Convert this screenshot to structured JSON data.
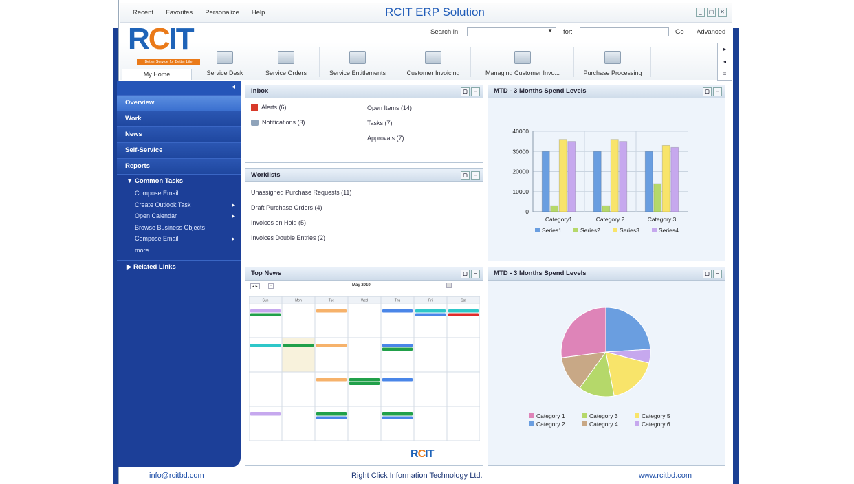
{
  "app": {
    "title": "RCIT ERP Solution",
    "menu": [
      "Recent",
      "Favorites",
      "Personalize",
      "Help"
    ],
    "window_buttons": {
      "minimize": "_",
      "restore": "▢",
      "close": "✕"
    }
  },
  "logo": {
    "text_r": "R",
    "text_c": "C",
    "text_it": "IT",
    "tagline": "Better Service for Better Life"
  },
  "search": {
    "search_in_label": "Search in:",
    "for_label": "for:",
    "go_label": "Go",
    "advanced_label": "Advanced"
  },
  "nav": {
    "home_label": "My Home",
    "items": [
      "Service Desk",
      "Service Orders",
      "Service Entitlements",
      "Customer Invoicing",
      "Managing Customer Invo...",
      "Purchase Processing"
    ],
    "arrows": [
      "▸",
      "◂",
      "≡"
    ]
  },
  "sidebar": {
    "collapse_glyph": "◂",
    "items": [
      "Overview",
      "Work",
      "News",
      "Self-Service",
      "Reports"
    ],
    "common_tasks_label": "Common Tasks",
    "tasks": [
      {
        "label": "Compose Email",
        "arrow": ""
      },
      {
        "label": "Create Outlook Task",
        "arrow": "▸"
      },
      {
        "label": "Open Calendar",
        "arrow": "▸"
      },
      {
        "label": "Browse Business Objects",
        "arrow": ""
      },
      {
        "label": "Compose Email",
        "arrow": "▸"
      },
      {
        "label": "more...",
        "arrow": ""
      }
    ],
    "related_links_label": "Related Links"
  },
  "inbox": {
    "title": "Inbox",
    "alerts": "Alerts (6)",
    "notifications": "Notifications (3)",
    "open_items": "Open Items (14)",
    "tasks": "Tasks (7)",
    "approvals": "Approvals (7)"
  },
  "worklists": {
    "title": "Worklists",
    "items": [
      "Unassigned Purchase Requests (11)",
      "Draft Purchase Orders (4)",
      "Invoices on Hold (5)",
      "Invoices Double Entries (2)"
    ]
  },
  "top_news": {
    "title": "Top News",
    "month": "May 2010",
    "days": [
      "Sun",
      "Mon",
      "Tue",
      "Wed",
      "Thu",
      "Fri",
      "Sat"
    ]
  },
  "bar_panel": {
    "title": "MTD - 3 Months Spend Levels"
  },
  "pie_panel": {
    "title": "MTD - 3 Months Spend Levels"
  },
  "chart_data": [
    {
      "type": "bar",
      "categories": [
        "Category1",
        "Category 2",
        "Category 3"
      ],
      "series": [
        {
          "name": "Series1",
          "values": [
            30000,
            30000,
            30000
          ]
        },
        {
          "name": "Series2",
          "values": [
            3000,
            3000,
            14000
          ]
        },
        {
          "name": "Series3",
          "values": [
            36000,
            36000,
            33000
          ]
        },
        {
          "name": "Series4",
          "values": [
            35000,
            35000,
            32000
          ]
        }
      ],
      "ylim": [
        0,
        40000
      ],
      "yticks": [
        "0",
        "10000",
        "20000",
        "30000",
        "40000"
      ],
      "colors": [
        "#6a9ee0",
        "#b5d86a",
        "#f8e46a",
        "#c6a8ee"
      ],
      "legend": "bottom",
      "grid": true
    },
    {
      "type": "pie",
      "categories": [
        "Category 1",
        "Category 2",
        "Category 3",
        "Category 4",
        "Category 5",
        "Category 6"
      ],
      "values": [
        27,
        24,
        13,
        13,
        18,
        5
      ],
      "colors": [
        "#de84b8",
        "#6a9ee0",
        "#b5d86a",
        "#c8a886",
        "#f8e46a",
        "#c6a8ee"
      ],
      "legend": "bottom"
    }
  ],
  "footer": {
    "email": "info@rcitbd.com",
    "company": "Right Click Information Technology Ltd.",
    "website": "www.rcitbd.com"
  }
}
